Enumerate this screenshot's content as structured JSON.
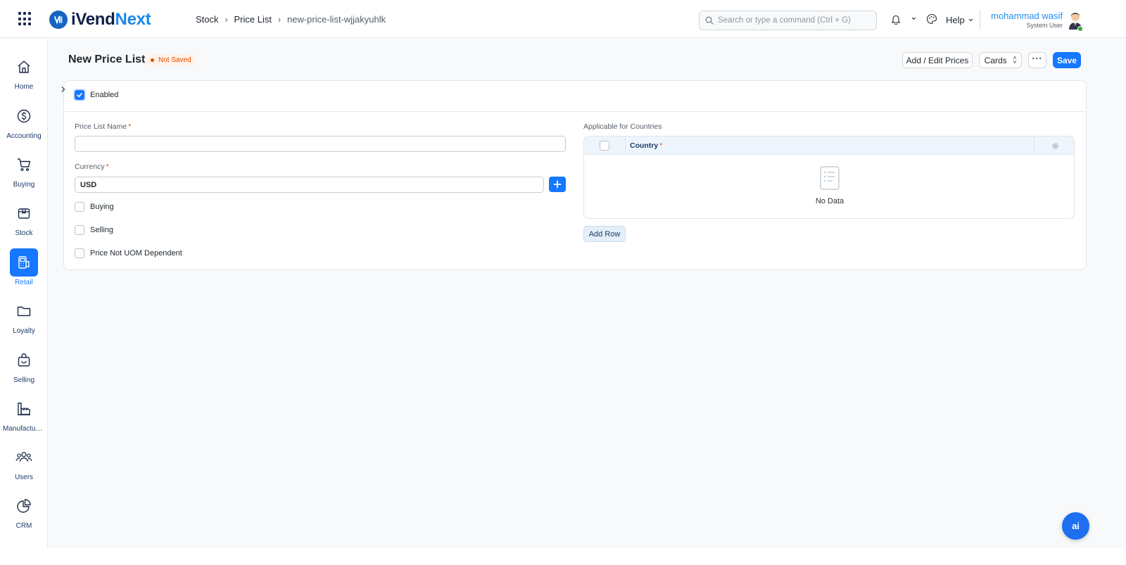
{
  "app": {
    "logo_part1": "iVend",
    "logo_part2": "Next",
    "brand_color": "#1e88e5",
    "accent_color": "#1677ff"
  },
  "breadcrumb": [
    "Stock",
    "Price List",
    "new-price-list-wjjakyuhlk"
  ],
  "search": {
    "placeholder": "Search or type a command (Ctrl + G)",
    "value": ""
  },
  "header": {
    "help_label": "Help",
    "user_name": "mohammad wasif",
    "user_role": "System User"
  },
  "sidebar": {
    "items": [
      {
        "label": "Home",
        "icon": "home-icon",
        "active": false
      },
      {
        "label": "Accounting",
        "icon": "dollar-icon",
        "active": false
      },
      {
        "label": "Buying",
        "icon": "cart-icon",
        "active": false
      },
      {
        "label": "Stock",
        "icon": "box-icon",
        "active": false
      },
      {
        "label": "Retail",
        "icon": "pos-terminal-icon",
        "active": true
      },
      {
        "label": "Loyalty",
        "icon": "folder-icon",
        "active": false
      },
      {
        "label": "Selling",
        "icon": "shopping-bag-icon",
        "active": false
      },
      {
        "label": "Manufacturing",
        "icon": "factory-icon",
        "active": false
      },
      {
        "label": "Users",
        "icon": "users-icon",
        "active": false
      },
      {
        "label": "CRM",
        "icon": "pie-chart-icon",
        "active": false
      }
    ]
  },
  "page": {
    "title": "New Price List",
    "status": "Not Saved",
    "status_color": "#e24c00",
    "actions": {
      "add_edit_prices": "Add / Edit Prices",
      "view_mode": "Cards",
      "more": "···",
      "save": "Save"
    }
  },
  "form": {
    "enabled_label": "Enabled",
    "enabled_checked": true,
    "price_list_name": {
      "label": "Price List Name",
      "value": ""
    },
    "currency": {
      "label": "Currency",
      "value": "USD"
    },
    "buying_label": "Buying",
    "selling_label": "Selling",
    "price_not_uom_label": "Price Not UOM Dependent",
    "countries": {
      "label": "Applicable for Countries",
      "column": "Country",
      "empty_text": "No Data",
      "add_row": "Add Row"
    }
  },
  "assistant": {
    "label": "ai"
  }
}
